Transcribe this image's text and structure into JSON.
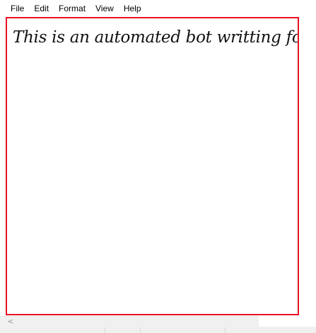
{
  "menu": {
    "items": [
      {
        "label": "File"
      },
      {
        "label": "Edit"
      },
      {
        "label": "Format"
      },
      {
        "label": "View"
      },
      {
        "label": "Help"
      }
    ]
  },
  "editor": {
    "text": "This is an automated bot writting fo",
    "highlight_color": "#e81123"
  },
  "scrollbar": {
    "left_arrow_icon": "chevron-left-icon",
    "left_arrow_glyph": "<"
  }
}
